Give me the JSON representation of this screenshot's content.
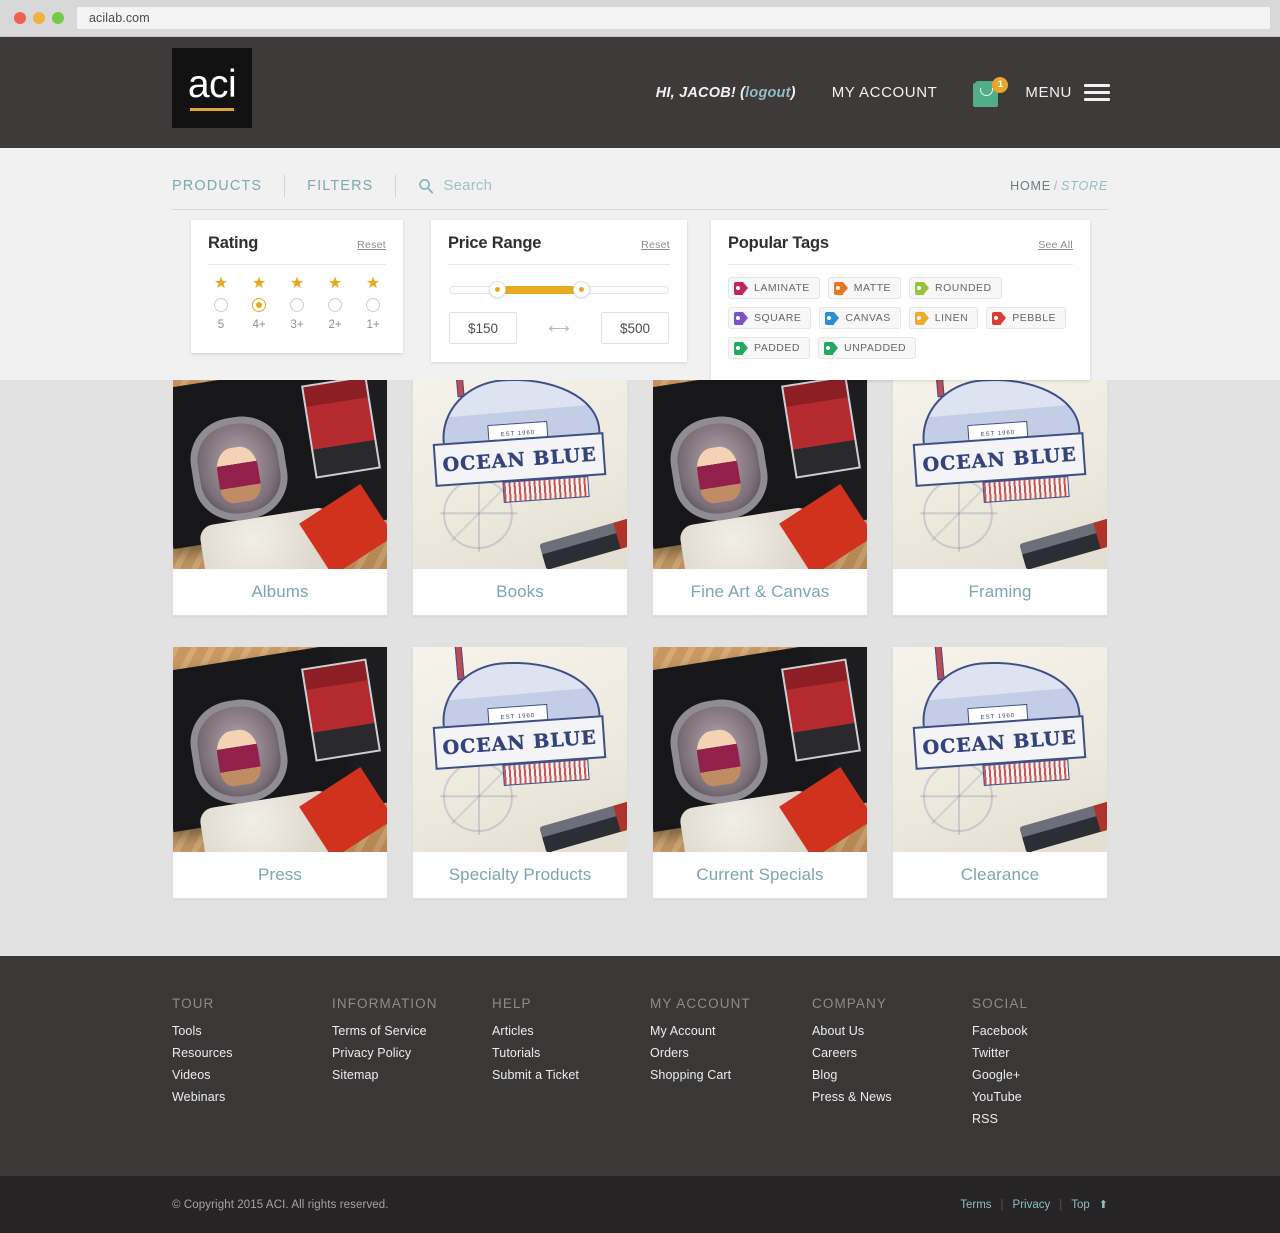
{
  "browser": {
    "url": "acilab.com",
    "traffic_lights": [
      "close-red",
      "minimize-yellow",
      "maximize-green"
    ]
  },
  "header": {
    "logo_text": "aci",
    "greeting_prefix": "HI, JACOB! (",
    "greeting_logout": "logout",
    "greeting_suffix": ")",
    "my_account": "MY ACCOUNT",
    "cart_icon": "shopping-bag-icon",
    "cart_count": "1",
    "menu_label": "MENU",
    "menu_icon": "hamburger-icon"
  },
  "utilnav": {
    "products": "PRODUCTS",
    "filters": "FILTERS",
    "search_icon": "search-icon",
    "search_placeholder": "Search",
    "breadcrumb_home": "HOME",
    "breadcrumb_sep": "/",
    "breadcrumb_store": "STORE"
  },
  "filters": {
    "rating": {
      "title": "Rating",
      "reset": "Reset",
      "options": [
        {
          "label": "5",
          "stars": 1,
          "selected": false
        },
        {
          "label": "4+",
          "stars": 1,
          "selected": true
        },
        {
          "label": "3+",
          "stars": 1,
          "selected": false
        },
        {
          "label": "2+",
          "stars": 1,
          "selected": false
        },
        {
          "label": "1+",
          "stars": 1,
          "selected": false
        }
      ],
      "star_color": "#e5a91f",
      "selected_value": "4+"
    },
    "price": {
      "title": "Price Range",
      "reset": "Reset",
      "min_value": "$150",
      "max_value": "$500",
      "slider_fill_color": "#e7aa21",
      "slider_low_pct": 22,
      "slider_high_pct": 60,
      "range_icon": "left-right-arrow-icon"
    },
    "tags": {
      "title": "Popular Tags",
      "see_all": "See All",
      "items": [
        {
          "label": "LAMINATE",
          "color": "#c2255c"
        },
        {
          "label": "MATTE",
          "color": "#e8761f"
        },
        {
          "label": "ROUNDED",
          "color": "#93c53d"
        },
        {
          "label": "SQUARE",
          "color": "#7a52c6"
        },
        {
          "label": "CANVAS",
          "color": "#2b8fd4"
        },
        {
          "label": "LINEN",
          "color": "#eeab2e"
        },
        {
          "label": "PEBBLE",
          "color": "#d93d35"
        },
        {
          "label": "PADDED",
          "color": "#23a95f"
        },
        {
          "label": "UNPADDED",
          "color": "#23a95f"
        }
      ]
    }
  },
  "products": [
    {
      "label": "Albums",
      "art": "album"
    },
    {
      "label": "Books",
      "art": "ocean"
    },
    {
      "label": "Fine Art & Canvas",
      "art": "album"
    },
    {
      "label": "Framing",
      "art": "ocean"
    },
    {
      "label": "Press",
      "art": "album"
    },
    {
      "label": "Specialty Products",
      "art": "ocean"
    },
    {
      "label": "Current Specials",
      "art": "album"
    },
    {
      "label": "Clearance",
      "art": "ocean"
    }
  ],
  "footer": {
    "columns": [
      {
        "title": "TOUR",
        "links": [
          "Tools",
          "Resources",
          "Videos",
          "Webinars"
        ]
      },
      {
        "title": "INFORMATION",
        "links": [
          "Terms of Service",
          "Privacy Policy",
          "Sitemap"
        ]
      },
      {
        "title": "HELP",
        "links": [
          "Articles",
          "Tutorials",
          "Submit a Ticket"
        ]
      },
      {
        "title": "MY ACCOUNT",
        "links": [
          "My Account",
          "Orders",
          "Shopping Cart"
        ]
      },
      {
        "title": "COMPANY",
        "links": [
          "About Us",
          "Careers",
          "Blog",
          "Press & News"
        ]
      },
      {
        "title": "SOCIAL",
        "links": [
          "Facebook",
          "Twitter",
          "Google+",
          "YouTube",
          "RSS"
        ]
      }
    ],
    "copyright": "© Copyright 2015 ACI. All rights reserved.",
    "bottom_links": [
      "Terms",
      "Privacy",
      "Top"
    ],
    "top_icon": "arrow-up-icon"
  },
  "ocean_art": {
    "banner_text": "OCEAN BLUE",
    "est_text": "EST 1960"
  }
}
